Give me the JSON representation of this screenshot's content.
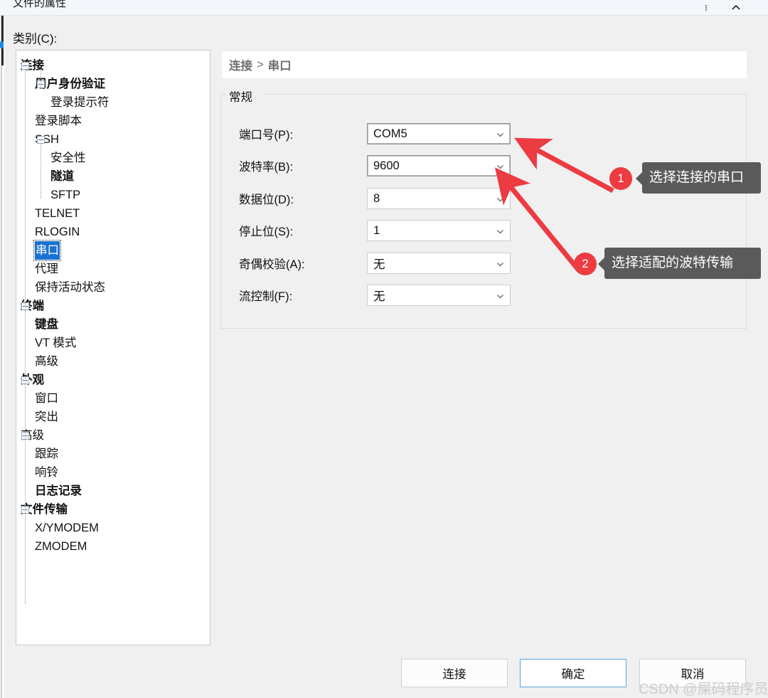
{
  "window": {
    "title": "文件的属性",
    "menu_icon": "vertical-dots-icon",
    "collapse_icon": "chevron-up-icon"
  },
  "category": {
    "label": "类别(C):",
    "tree": [
      {
        "label": "连接",
        "level": 0,
        "bold": true,
        "expander": true,
        "selected": false
      },
      {
        "label": "用户身份验证",
        "level": 1,
        "bold": true,
        "expander": true,
        "selected": false
      },
      {
        "label": "登录提示符",
        "level": 2,
        "bold": false,
        "expander": false,
        "selected": false
      },
      {
        "label": "登录脚本",
        "level": 1,
        "bold": false,
        "expander": false,
        "selected": false
      },
      {
        "label": "SSH",
        "level": 1,
        "bold": false,
        "expander": true,
        "selected": false
      },
      {
        "label": "安全性",
        "level": 2,
        "bold": false,
        "expander": false,
        "selected": false
      },
      {
        "label": "隧道",
        "level": 2,
        "bold": true,
        "expander": false,
        "selected": false
      },
      {
        "label": "SFTP",
        "level": 2,
        "bold": false,
        "expander": false,
        "selected": false
      },
      {
        "label": "TELNET",
        "level": 1,
        "bold": false,
        "expander": false,
        "selected": false
      },
      {
        "label": "RLOGIN",
        "level": 1,
        "bold": false,
        "expander": false,
        "selected": false
      },
      {
        "label": "串口",
        "level": 1,
        "bold": false,
        "expander": false,
        "selected": true
      },
      {
        "label": "代理",
        "level": 1,
        "bold": false,
        "expander": false,
        "selected": false
      },
      {
        "label": "保持活动状态",
        "level": 1,
        "bold": false,
        "expander": false,
        "selected": false
      },
      {
        "label": "终端",
        "level": 0,
        "bold": true,
        "expander": true,
        "selected": false
      },
      {
        "label": "键盘",
        "level": 1,
        "bold": true,
        "expander": false,
        "selected": false
      },
      {
        "label": "VT 模式",
        "level": 1,
        "bold": false,
        "expander": false,
        "selected": false
      },
      {
        "label": "高级",
        "level": 1,
        "bold": false,
        "expander": false,
        "selected": false
      },
      {
        "label": "外观",
        "level": 0,
        "bold": true,
        "expander": true,
        "selected": false
      },
      {
        "label": "窗口",
        "level": 1,
        "bold": false,
        "expander": false,
        "selected": false
      },
      {
        "label": "突出",
        "level": 1,
        "bold": false,
        "expander": false,
        "selected": false
      },
      {
        "label": "高级",
        "level": 0,
        "bold": false,
        "expander": true,
        "selected": false
      },
      {
        "label": "跟踪",
        "level": 1,
        "bold": false,
        "expander": false,
        "selected": false
      },
      {
        "label": "响铃",
        "level": 1,
        "bold": false,
        "expander": false,
        "selected": false
      },
      {
        "label": "日志记录",
        "level": 1,
        "bold": true,
        "expander": false,
        "selected": false
      },
      {
        "label": "文件传输",
        "level": 0,
        "bold": true,
        "expander": true,
        "selected": false
      },
      {
        "label": "X/YMODEM",
        "level": 1,
        "bold": false,
        "expander": false,
        "selected": false
      },
      {
        "label": "ZMODEM",
        "level": 1,
        "bold": false,
        "expander": false,
        "selected": false
      }
    ]
  },
  "breadcrumb": {
    "root": "连接",
    "separator": ">",
    "current": "串口"
  },
  "group": {
    "title": "常规",
    "fields": [
      {
        "label": "端口号(P):",
        "value": "COM5",
        "name": "port-number"
      },
      {
        "label": "波特率(B):",
        "value": "9600",
        "name": "baud-rate"
      },
      {
        "label": "数据位(D):",
        "value": "8",
        "name": "data-bits"
      },
      {
        "label": "停止位(S):",
        "value": "1",
        "name": "stop-bits"
      },
      {
        "label": "奇偶校验(A):",
        "value": "无",
        "name": "parity"
      },
      {
        "label": "流控制(F):",
        "value": "无",
        "name": "flow-control"
      }
    ]
  },
  "annotations": [
    {
      "badge": "1",
      "text": "选择连接的串口"
    },
    {
      "badge": "2",
      "text": "选择适配的波特传输"
    }
  ],
  "annotation_color": "#ec3b41",
  "buttons": {
    "connect": "连接",
    "ok": "确定",
    "cancel": "取消"
  },
  "watermark": "CSDN @屎码程序员"
}
